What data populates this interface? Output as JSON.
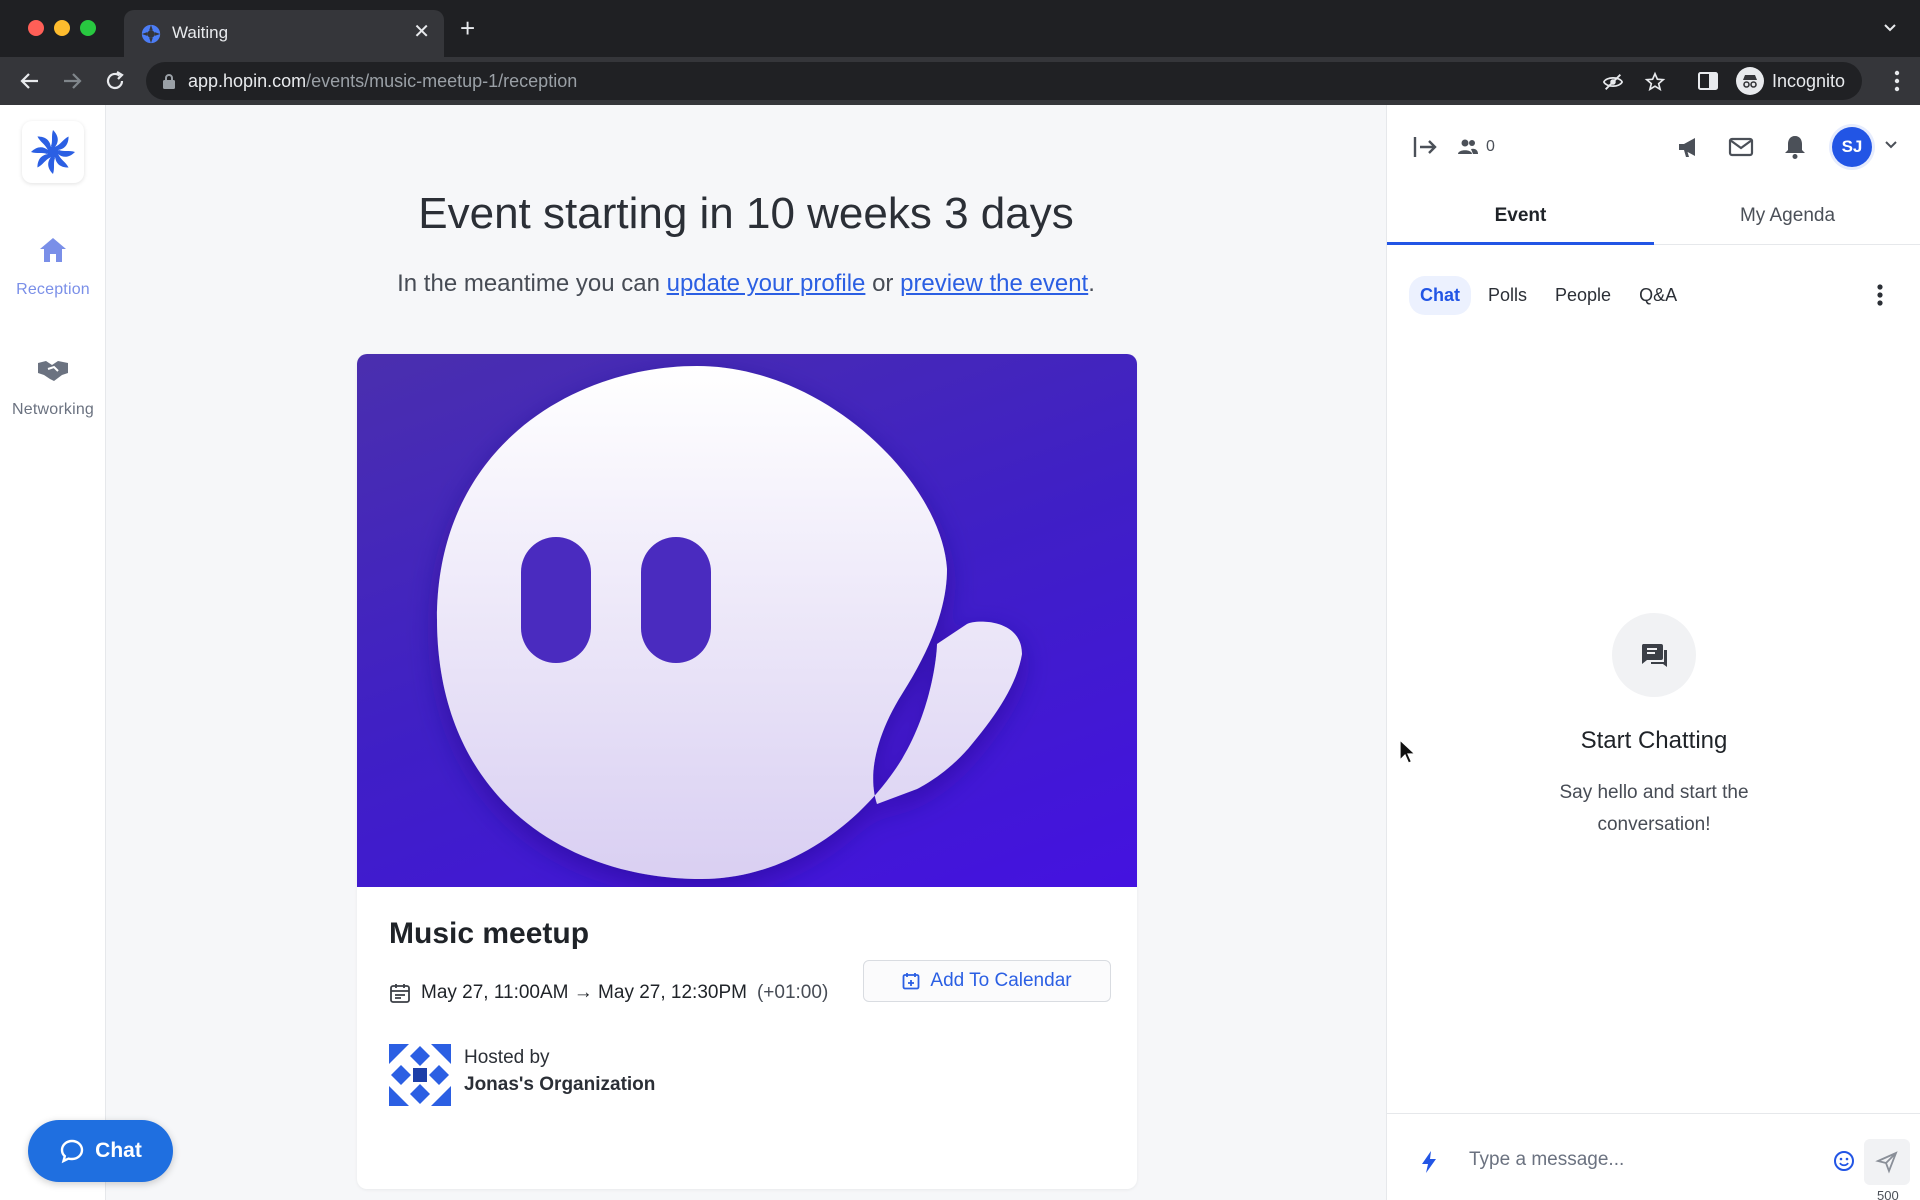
{
  "browser": {
    "tab_title": "Waiting",
    "url_host": "app.hopin.com",
    "url_path": "/events/music-meetup-1/reception",
    "profile_label": "Incognito"
  },
  "sidebar": {
    "items": [
      {
        "label": "Reception",
        "icon": "home-icon",
        "active": true
      },
      {
        "label": "Networking",
        "icon": "handshake-icon",
        "active": false
      }
    ]
  },
  "main": {
    "headline": "Event starting in 10 weeks 3 days",
    "sub_prefix": "In the meantime you can ",
    "link_profile": "update your profile",
    "sub_middle": " or ",
    "link_preview": "preview the event",
    "sub_suffix": ".",
    "event": {
      "title": "Music meetup",
      "time_range": "May 27, 11:00AM → May 27, 12:30PM",
      "timezone": "(+01:00)",
      "add_to_calendar": "Add To Calendar",
      "hosted_by_label": "Hosted by",
      "host_name": "Jonas's Organization"
    },
    "chat_button": "Chat"
  },
  "panel": {
    "attendee_count": "0",
    "avatar_initials": "SJ",
    "tabs": [
      "Event",
      "My Agenda"
    ],
    "subtabs": [
      "Chat",
      "Polls",
      "People",
      "Q&A"
    ],
    "empty_title": "Start Chatting",
    "empty_subtitle": "Say hello and start the conversation!",
    "composer_placeholder": "Type a message...",
    "char_limit": "500"
  },
  "colors": {
    "accent": "#2255e5",
    "link": "#2b5fe3",
    "banner_purple": "#4412e0",
    "chat_fab": "#1f6fe0"
  }
}
